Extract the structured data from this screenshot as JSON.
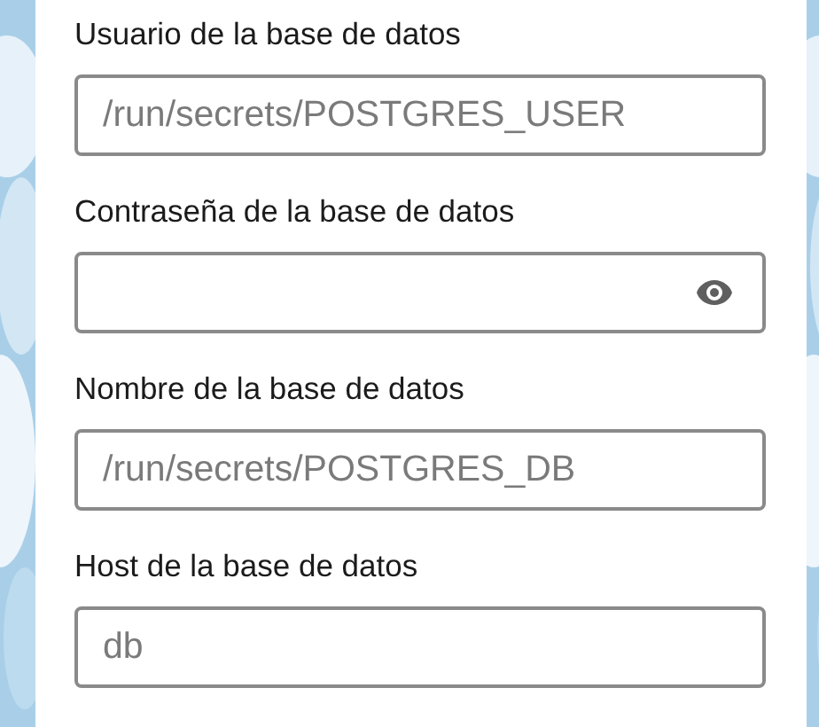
{
  "fields": [
    {
      "label": "Usuario de la base de datos",
      "kind": "text",
      "placeholder": "/run/secrets/POSTGRES_USER"
    },
    {
      "label": "Contraseña de la base de datos",
      "kind": "password"
    },
    {
      "label": "Nombre de la base de datos",
      "kind": "text",
      "placeholder": "/run/secrets/POSTGRES_DB"
    },
    {
      "label": "Host de la base de datos",
      "kind": "text",
      "placeholder": "db"
    }
  ]
}
